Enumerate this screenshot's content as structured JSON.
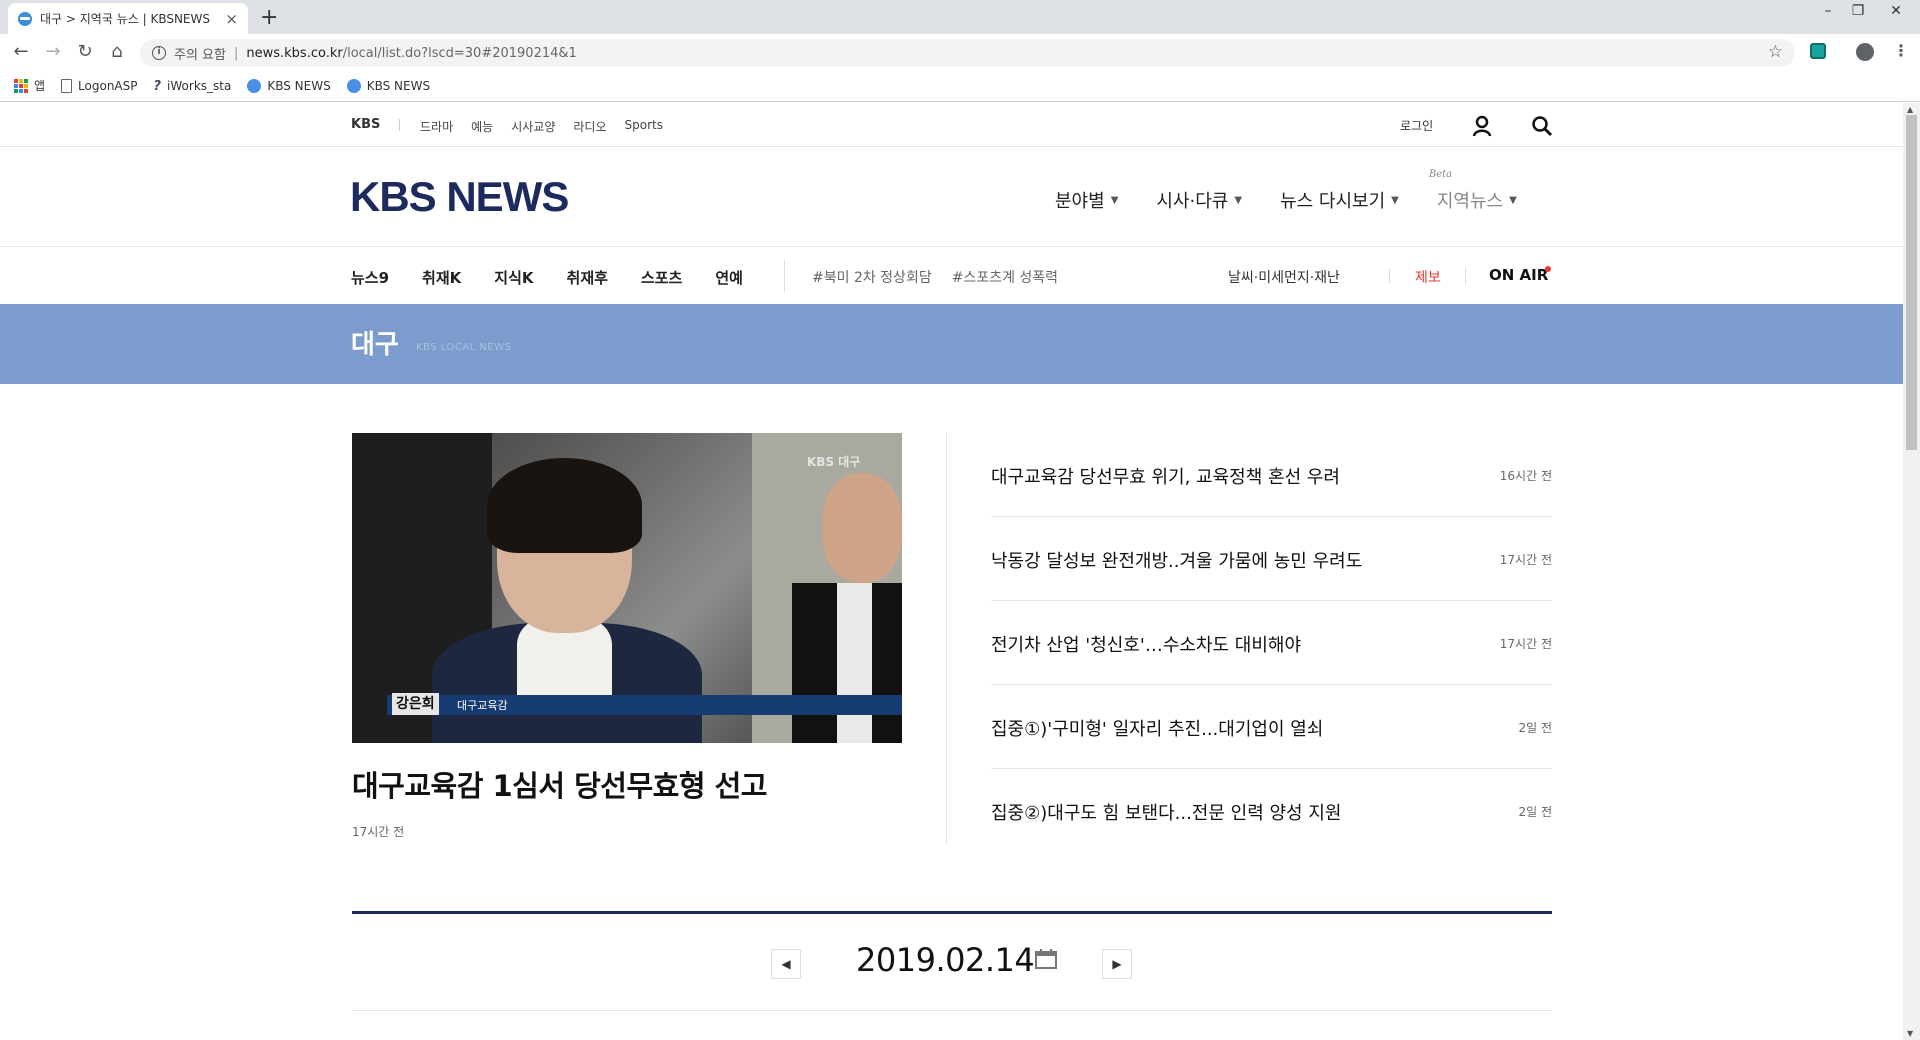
{
  "browser": {
    "tab_title": "대구 > 지역국 뉴스 | KBSNEWS",
    "url_warning": "주의 요함",
    "url_host": "news.kbs.co.kr",
    "url_path": "/local/list.do?lscd=30#20190214&1",
    "bookmarks": [
      {
        "label": "앱",
        "icon": "apps-icon"
      },
      {
        "label": "LogonASP",
        "icon": "document-icon"
      },
      {
        "label": "iWorks_sta",
        "icon": "iworks-icon"
      },
      {
        "label": "KBS NEWS",
        "icon": "kbs-globe-icon"
      },
      {
        "label": "KBS NEWS",
        "icon": "kbs-globe-icon"
      }
    ]
  },
  "topstrip": {
    "brand": "KBS",
    "categories": [
      "드라마",
      "예능",
      "시사교양",
      "라디오",
      "Sports"
    ],
    "login": "로그인"
  },
  "header": {
    "logo": "KBS NEWS",
    "nav": [
      {
        "label": "분야별"
      },
      {
        "label": "시사·다큐"
      },
      {
        "label": "뉴스 다시보기"
      },
      {
        "label": "지역뉴스",
        "badge": "Beta"
      }
    ]
  },
  "subnav": {
    "items": [
      "뉴스9",
      "취재K",
      "지식K",
      "취재후",
      "스포츠",
      "연예"
    ],
    "tags": [
      "#북미 2차 정상회담",
      "#스포츠계 성폭력"
    ],
    "weather": "날씨·미세먼지·재난",
    "report": "제보",
    "onair": "ON AIR"
  },
  "banner": {
    "region": "대구",
    "subtitle": "KBS LOCAL NEWS"
  },
  "lead": {
    "watermark": "KBS 대구",
    "caption_name": "강은희",
    "caption_title": "대구교육감",
    "title": "대구교육감 1심서 당선무효형 선고",
    "time": "17시간 전"
  },
  "news_list": [
    {
      "headline": "대구교육감 당선무효 위기, 교육정책 혼선 우려",
      "time": "16시간 전"
    },
    {
      "headline": "낙동강 달성보 완전개방..겨울 가뭄에 농민 우려도",
      "time": "17시간 전"
    },
    {
      "headline": "전기차 산업 '청신호'…수소차도 대비해야",
      "time": "17시간 전"
    },
    {
      "headline": "집중①)'구미형' 일자리 추진...대기업이 열쇠",
      "time": "2일 전"
    },
    {
      "headline": "집중②)대구도 힘 보탠다...전문 인력 양성 지원",
      "time": "2일 전"
    }
  ],
  "date_nav": {
    "date": "2019.02.14",
    "prev": "◀",
    "next": "▶"
  },
  "colors": {
    "logo": "#1c2a5e",
    "banner": "#7b9ccc",
    "report": "#e53935",
    "onair_dot": "#e53935"
  }
}
